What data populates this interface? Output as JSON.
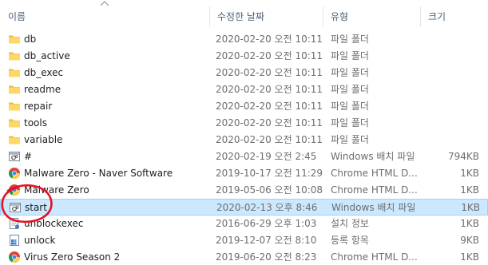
{
  "header": {
    "name": "이름",
    "date": "수정한 날짜",
    "type": "유형",
    "size": "크기"
  },
  "colors": {
    "header_text": "#4c607a",
    "selection_bg": "#cce8ff",
    "selection_border": "#99d1ff",
    "folder": "#ffd764",
    "annotation": "#e81123"
  },
  "files": [
    {
      "name": "db",
      "date": "2020-02-20 오전 10:11",
      "type": "파일 폴더",
      "size": "",
      "icon": "folder-icon"
    },
    {
      "name": "db_active",
      "date": "2020-02-20 오전 10:11",
      "type": "파일 폴더",
      "size": "",
      "icon": "folder-icon"
    },
    {
      "name": "db_exec",
      "date": "2020-02-20 오전 10:11",
      "type": "파일 폴더",
      "size": "",
      "icon": "folder-icon"
    },
    {
      "name": "readme",
      "date": "2020-02-20 오전 10:11",
      "type": "파일 폴더",
      "size": "",
      "icon": "folder-icon"
    },
    {
      "name": "repair",
      "date": "2020-02-20 오전 10:11",
      "type": "파일 폴더",
      "size": "",
      "icon": "folder-icon"
    },
    {
      "name": "tools",
      "date": "2020-02-20 오전 10:11",
      "type": "파일 폴더",
      "size": "",
      "icon": "folder-icon"
    },
    {
      "name": "variable",
      "date": "2020-02-20 오전 10:11",
      "type": "파일 폴더",
      "size": "",
      "icon": "folder-icon"
    },
    {
      "name": "#",
      "date": "2020-02-19 오전 2:45",
      "type": "Windows 배치 파일",
      "size": "794KB",
      "icon": "batch-file-icon"
    },
    {
      "name": "Malware Zero - Naver Software",
      "date": "2019-10-17 오전 11:29",
      "type": "Chrome HTML D...",
      "size": "1KB",
      "icon": "chrome-icon"
    },
    {
      "name": "Malware Zero",
      "date": "2019-05-06 오전 10:08",
      "type": "Chrome HTML D...",
      "size": "1KB",
      "icon": "chrome-icon"
    },
    {
      "name": "start",
      "date": "2020-02-13 오후 8:46",
      "type": "Windows 배치 파일",
      "size": "1KB",
      "icon": "batch-file-icon",
      "selected": true
    },
    {
      "name": "unblockexec",
      "date": "2016-06-29 오후 1:03",
      "type": "설치 정보",
      "size": "1KB",
      "icon": "setup-info-icon"
    },
    {
      "name": "unlock",
      "date": "2019-12-07 오전 8:10",
      "type": "등록 항목",
      "size": "9KB",
      "icon": "registry-icon"
    },
    {
      "name": "Virus Zero Season 2",
      "date": "2019-06-20 오전 8:23",
      "type": "Chrome HTML D...",
      "size": "1KB",
      "icon": "chrome-icon"
    }
  ]
}
